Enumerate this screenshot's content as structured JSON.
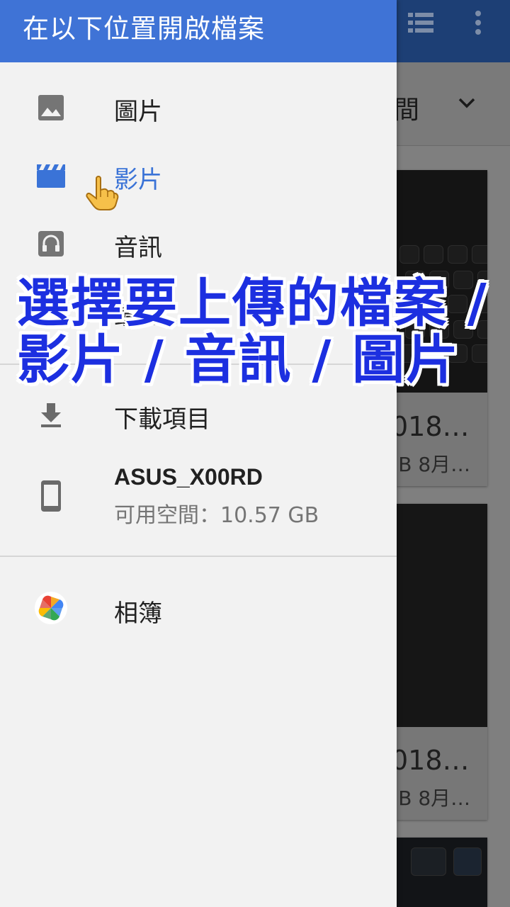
{
  "drawer": {
    "title": "在以下位置開啟檔案",
    "items": [
      {
        "label": "圖片",
        "icon": "image-icon"
      },
      {
        "label": "影片",
        "icon": "video-icon",
        "active": true
      },
      {
        "label": "音訊",
        "icon": "headphones-icon"
      },
      {
        "label": "最近",
        "icon": "clock-icon"
      },
      {
        "label": "下載項目",
        "icon": "download-icon"
      }
    ],
    "storage": {
      "name": "ASUS_X00RD",
      "free": "可用空間：10.57 GB",
      "icon": "phone-icon"
    },
    "photos": {
      "label": "相簿",
      "icon": "google-photos-icon"
    }
  },
  "background": {
    "sort_label": "間",
    "cards": [
      {
        "title": "018…",
        "subtitle": "IB 8月…"
      },
      {
        "title": "018…",
        "subtitle": "IB 8月…"
      }
    ]
  },
  "caption": {
    "line1": "選擇要上傳的檔案 /",
    "line2": "影片 / 音訊 / 圖片"
  },
  "colors": {
    "header_blue": "#3f73d6",
    "active_blue": "#3a73d7",
    "caption_blue": "#1c2fe0"
  }
}
